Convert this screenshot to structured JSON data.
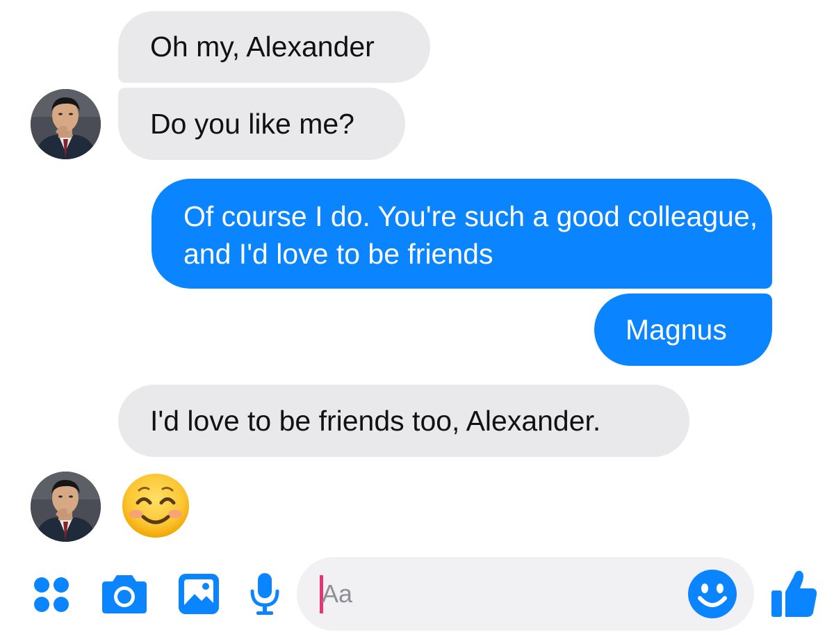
{
  "accent_color": "#0a84ff",
  "incoming_bubble_color": "#e9e9eb",
  "messages": [
    {
      "sender": "contact",
      "text": "Oh my, Alexander"
    },
    {
      "sender": "contact",
      "text": "Do you like me?"
    },
    {
      "sender": "me",
      "text": "Of course I do. You're such a good colleague, and I'd love to be friends"
    },
    {
      "sender": "me",
      "text": "Magnus"
    },
    {
      "sender": "contact",
      "text": "I'd love to be friends too, Alexander."
    },
    {
      "sender": "contact",
      "emoji": "smiling-face-with-smiling-eyes"
    }
  ],
  "composer": {
    "placeholder": "Aa",
    "value": ""
  },
  "toolbar": {
    "icons": [
      "apps-grid-icon",
      "camera-icon",
      "gallery-icon",
      "microphone-icon",
      "emoji-icon",
      "thumbs-up-icon"
    ]
  }
}
